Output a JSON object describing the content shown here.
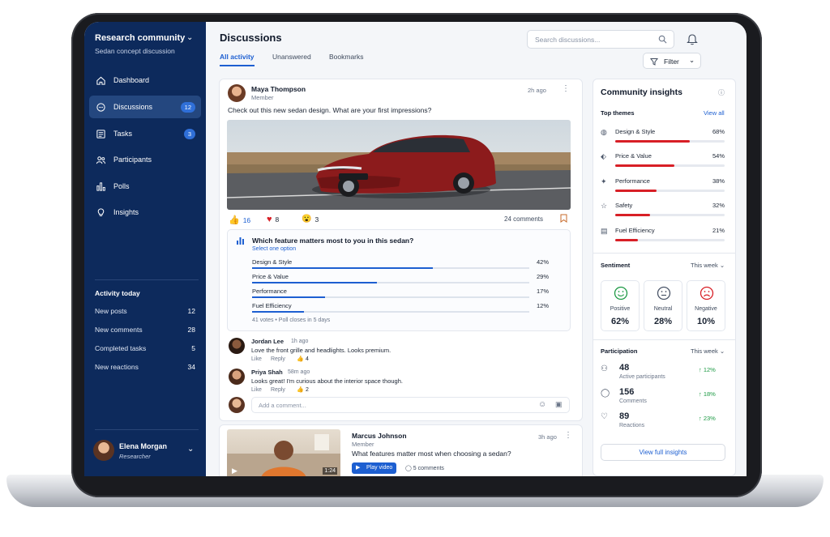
{
  "sidebar": {
    "community": "Research community",
    "subtitle": "Sedan concept discussion",
    "items": [
      {
        "label": "Dashboard",
        "count": null
      },
      {
        "label": "Discussions",
        "count": "12"
      },
      {
        "label": "Tasks",
        "count": "3"
      },
      {
        "label": "Participants",
        "count": null
      },
      {
        "label": "Polls",
        "count": null
      },
      {
        "label": "Insights",
        "count": null
      }
    ],
    "activity_title": "Activity today",
    "activity": [
      {
        "label": "New posts",
        "value": "12"
      },
      {
        "label": "New comments",
        "value": "28"
      },
      {
        "label": "Completed tasks",
        "value": "5"
      },
      {
        "label": "New reactions",
        "value": "34"
      }
    ],
    "user": {
      "name": "Elena Morgan",
      "role": "Researcher"
    }
  },
  "header": {
    "title": "Discussions",
    "tabs": [
      "All activity",
      "Unanswered",
      "Bookmarks"
    ],
    "search_placeholder": "Search discussions...",
    "filter_label": "Filter"
  },
  "post": {
    "author": "Maya Thompson",
    "role": "Member",
    "time": "2h ago",
    "text": "Check out this new sedan design. What are your first impressions?",
    "reactions": {
      "likes": "16",
      "hearts": "8",
      "wow": "3"
    },
    "comments_count": "24 comments",
    "poll": {
      "question": "Which feature matters most to you in this sedan?",
      "instruction": "Select one option",
      "options": [
        {
          "label": "Design & Style",
          "pct": "42%",
          "value": 42
        },
        {
          "label": "Price & Value",
          "pct": "29%",
          "value": 29
        },
        {
          "label": "Performance",
          "pct": "17%",
          "value": 17
        },
        {
          "label": "Fuel Efficiency",
          "pct": "12%",
          "value": 12
        }
      ],
      "footer": "41 votes • Poll closes in 5 days"
    },
    "comments": [
      {
        "name": "Jordan Lee",
        "time": "1h ago",
        "text": "Love the front grille and headlights. Looks premium.",
        "like": "Like",
        "reply": "Reply",
        "likes": "4"
      },
      {
        "name": "Priya Shah",
        "time": "58m ago",
        "text": "Looks great! I'm curious about the interior space though.",
        "like": "Like",
        "reply": "Reply",
        "likes": "2"
      }
    ],
    "add_comment_placeholder": "Add a comment..."
  },
  "post2": {
    "author": "Marcus Johnson",
    "role": "Member",
    "time": "3h ago",
    "text": "What features matter most when choosing a sedan?",
    "duration": "1:24",
    "play_label": "Play video",
    "comments": "5 comments"
  },
  "insights": {
    "title": "Community insights",
    "themes_title": "Top themes",
    "view_all": "View all",
    "themes": [
      {
        "label": "Design & Style",
        "pct": "68%",
        "value": 68,
        "icon": "palette-icon"
      },
      {
        "label": "Price & Value",
        "pct": "54%",
        "value": 54,
        "icon": "price-tag-icon"
      },
      {
        "label": "Performance",
        "pct": "38%",
        "value": 38,
        "icon": "sparkle-icon"
      },
      {
        "label": "Safety",
        "pct": "32%",
        "value": 32,
        "icon": "star-icon"
      },
      {
        "label": "Fuel Efficiency",
        "pct": "21%",
        "value": 21,
        "icon": "document-icon"
      }
    ],
    "sentiment_title": "Sentiment",
    "sentiment_range": "This week",
    "sentiment": [
      {
        "label": "Positive",
        "value": "62%",
        "color": "#1e9a45"
      },
      {
        "label": "Neutral",
        "value": "28%",
        "color": "#4a5568"
      },
      {
        "label": "Negative",
        "value": "10%",
        "color": "#d81f26"
      }
    ],
    "participation_title": "Participation",
    "participation_range": "This week",
    "participation": [
      {
        "value": "48",
        "label": "Active participants",
        "delta": "↑ 12%"
      },
      {
        "value": "156",
        "label": "Comments",
        "delta": "↑ 18%"
      },
      {
        "value": "89",
        "label": "Reactions",
        "delta": "↑ 23%"
      }
    ],
    "full_button": "View full insights"
  },
  "colors": {
    "sidebar": "#0d2a5c",
    "accent": "#1d5fd1",
    "theme_bar": "#d81f26",
    "positive": "#1e9a45"
  }
}
